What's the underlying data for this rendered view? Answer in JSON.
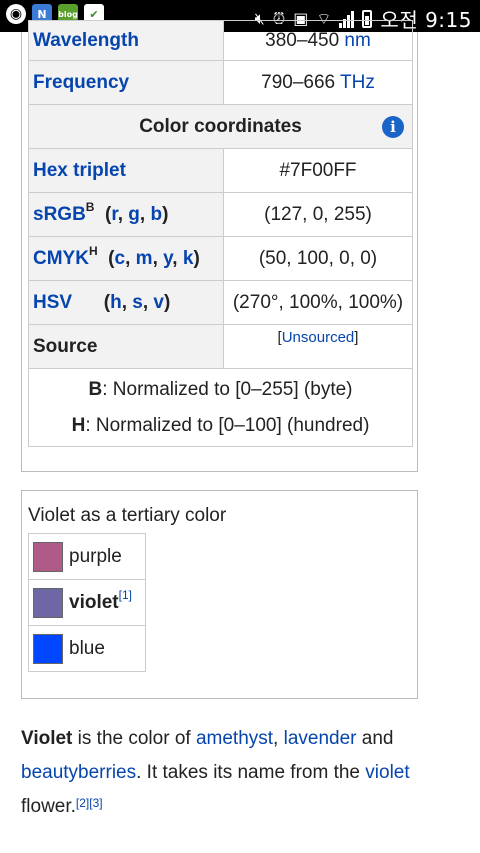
{
  "statusbar": {
    "time": "오전 9:15",
    "icons": [
      "navigation-icon",
      "n-icon",
      "blog-icon",
      "shield-icon",
      "mute-icon",
      "alarm-icon",
      "screenshot-icon",
      "wifi-icon",
      "signal-icon",
      "battery-icon"
    ],
    "n_label": "N",
    "blog_label": "blog"
  },
  "infobox": {
    "top_row": {
      "label": "Wavelength",
      "value": "380–450 nm",
      "value_num": "380–450",
      "value_unit": "nm"
    },
    "frequency": {
      "label": "Frequency",
      "value_num": "790–666",
      "value_unit": "THz"
    },
    "color_coordinates_header": "Color coordinates",
    "hex": {
      "label": "Hex triplet",
      "value": "#7F00FF"
    },
    "srgb": {
      "label": "sRGB",
      "sup": "B",
      "r": "r",
      "g": "g",
      "b": "b",
      "value": "(127, 0, 255)"
    },
    "cmyk": {
      "label": "CMYK",
      "sup": "H",
      "c": "c",
      "m": "m",
      "y": "y",
      "k": "k",
      "value": "(50, 100, 0, 0)"
    },
    "hsv": {
      "label": "HSV",
      "h": "h",
      "s": "s",
      "v": "v",
      "value": "(270°, 100%, 100%)"
    },
    "source": {
      "label": "Source",
      "value": "Unsourced"
    },
    "notes": {
      "b_key": "B",
      "b_text": ": Normalized to [0–255] (byte)",
      "h_key": "H",
      "h_text": ": Normalized to [0–100] (hundred)"
    }
  },
  "tertiary": {
    "title": "Violet as a tertiary color",
    "items": [
      {
        "label": "purple",
        "color": "#b05a8a"
      },
      {
        "label": "violet",
        "color": "#6e67a6",
        "ref": "[1]"
      },
      {
        "label": "blue",
        "color": "#0047ff"
      }
    ]
  },
  "paragraph": {
    "term": "Violet",
    "text1": " is the color of ",
    "link1": "amethyst",
    "text2": ", ",
    "link2": "lavender",
    "text3": " and ",
    "link3": "beautyberries",
    "text4": ". It takes its name from the ",
    "link4": "violet",
    "text5": " flower.",
    "refs": "[2][3]"
  },
  "colors": {
    "link": "#0645ad",
    "header_bg": "#f2f2f2",
    "info_icon": "#1a63c7"
  }
}
